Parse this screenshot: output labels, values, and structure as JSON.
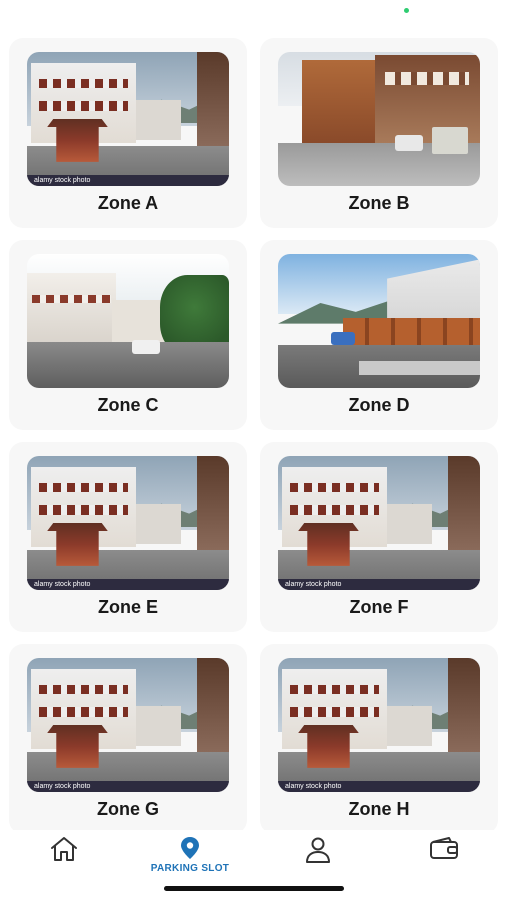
{
  "zones": [
    {
      "label": "Zone A",
      "watermark": "alamy stock photo",
      "scene": "square"
    },
    {
      "label": "Zone B",
      "watermark": "",
      "scene": "street"
    },
    {
      "label": "Zone C",
      "watermark": "",
      "scene": "corner"
    },
    {
      "label": "Zone D",
      "watermark": "",
      "scene": "road"
    },
    {
      "label": "Zone E",
      "watermark": "alamy stock photo",
      "scene": "square"
    },
    {
      "label": "Zone F",
      "watermark": "alamy stock photo",
      "scene": "square"
    },
    {
      "label": "Zone G",
      "watermark": "alamy stock photo",
      "scene": "square"
    },
    {
      "label": "Zone H",
      "watermark": "alamy stock photo",
      "scene": "square"
    }
  ],
  "nav": {
    "items": [
      {
        "icon": "home-icon",
        "label": ""
      },
      {
        "icon": "location-pin-icon",
        "label": "PARKING SLOT",
        "active": true
      },
      {
        "icon": "user-icon",
        "label": ""
      },
      {
        "icon": "wallet-icon",
        "label": ""
      }
    ],
    "active_color": "#1f73b7",
    "inactive_color": "#333333"
  },
  "status_dot_color": "#2ecc71"
}
